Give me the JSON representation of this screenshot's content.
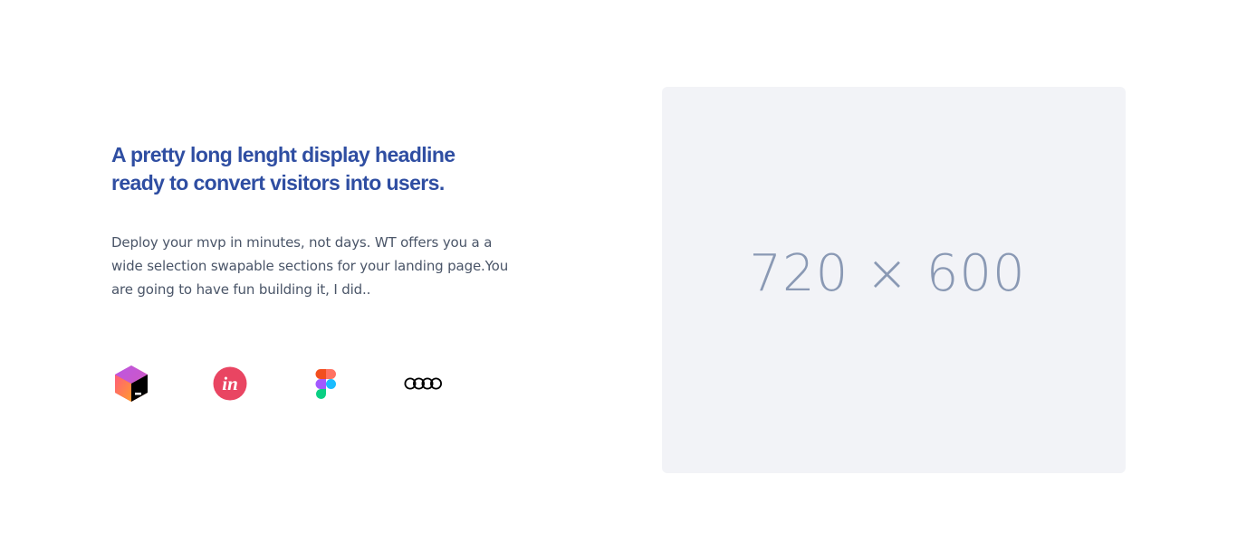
{
  "hero": {
    "headline": "A pretty long lenght display headline ready to convert visitors into users.",
    "description": "Deploy your mvp in minutes, not days. WT offers you a a wide selection swapable sections for your landing page.You are going to have fun building it, I did.."
  },
  "logos": [
    {
      "icon": "jetbrains-logo-icon"
    },
    {
      "icon": "invision-logo-icon"
    },
    {
      "icon": "figma-logo-icon"
    },
    {
      "icon": "audi-logo-icon"
    }
  ],
  "placeholder": {
    "label": "720 × 600"
  },
  "colors": {
    "headline": "#2f4ea2",
    "body_text": "#4a5568",
    "placeholder_bg": "#f2f3f7",
    "placeholder_text": "#8a99b4",
    "invision": "#e94562"
  }
}
